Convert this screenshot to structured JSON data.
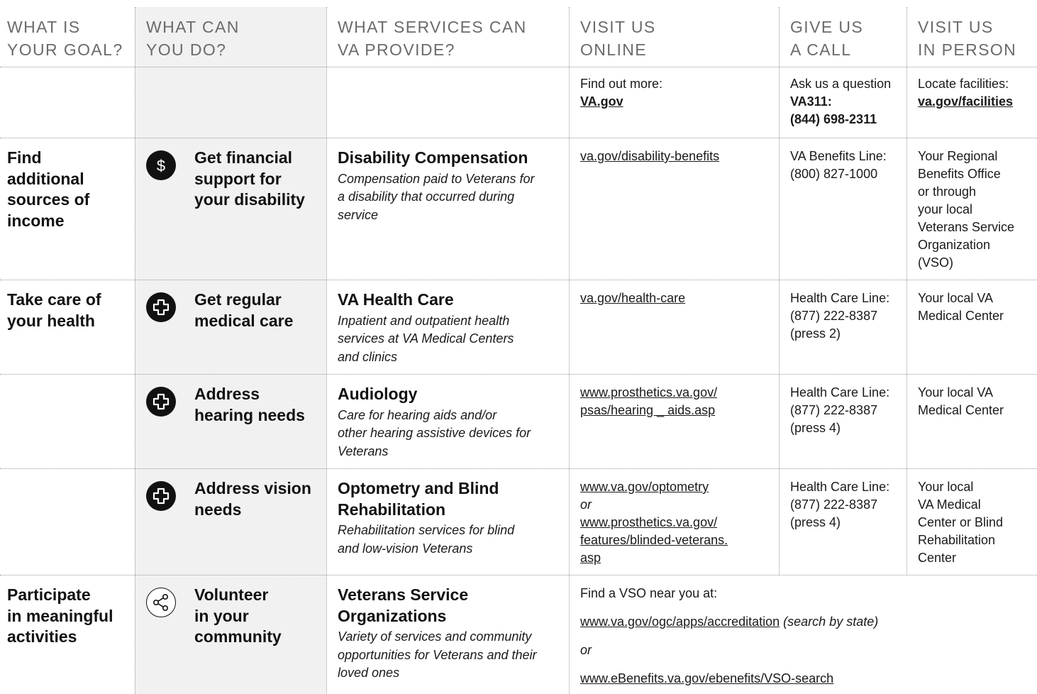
{
  "headers": {
    "goal": [
      "WHAT IS",
      "YOUR GOAL?"
    ],
    "do": [
      "WHAT CAN",
      "YOU DO?"
    ],
    "services": [
      "WHAT SERVICES CAN",
      "VA PROVIDE?"
    ],
    "online": [
      "VISIT US",
      "ONLINE"
    ],
    "call": [
      "GIVE US",
      "A CALL"
    ],
    "person": [
      "VISIT US",
      "IN PERSON"
    ]
  },
  "contact_row": {
    "online_label": "Find out more:",
    "online_link": "VA.gov",
    "call_label": "Ask us a question",
    "call_name": "VA311:",
    "call_number": "(844) 698-2311",
    "person_label": "Locate facilities:",
    "person_link": "va.gov/facilities"
  },
  "rows": [
    {
      "goal": [
        "Find",
        "additional",
        "sources of",
        "income"
      ],
      "icon": "dollar-icon",
      "action": [
        "Get financial",
        "support for",
        "your disability"
      ],
      "service_title": [
        "Disability Compensation"
      ],
      "service_desc": [
        "Compensation paid to Veterans for",
        "a disability that occurred during",
        "service"
      ],
      "online": [
        "va.gov/disability-benefits"
      ],
      "call": [
        "VA Benefits Line:",
        "(800) 827-1000"
      ],
      "person": [
        "Your Regional",
        "Benefits Office",
        "or through",
        "your local",
        "Veterans Service",
        "Organization",
        "(VSO)"
      ]
    },
    {
      "goal": [
        "Take care of",
        "your health"
      ],
      "icon": "medical-cross-icon",
      "action": [
        "Get regular",
        "medical care"
      ],
      "service_title": [
        "VA Health Care"
      ],
      "service_desc": [
        "Inpatient and outpatient health",
        "services at VA Medical Centers",
        "and clinics"
      ],
      "online": [
        "va.gov/health-care"
      ],
      "call": [
        "Health Care Line:",
        "(877) 222-8387",
        "(press 2)"
      ],
      "person": [
        "Your local VA",
        "Medical Center"
      ]
    },
    {
      "goal": [],
      "icon": "medical-cross-icon",
      "action": [
        "Address",
        "hearing needs"
      ],
      "service_title": [
        "Audiology"
      ],
      "service_desc": [
        "Care for hearing aids and/or",
        "other hearing assistive devices for",
        "Veterans"
      ],
      "online": [
        "www.prosthetics.va.gov/",
        "psas/hearing _ aids.asp"
      ],
      "call": [
        "Health Care Line:",
        "(877) 222-8387",
        "(press 4)"
      ],
      "person": [
        "Your local VA",
        "Medical Center"
      ]
    },
    {
      "goal": [],
      "icon": "medical-cross-icon",
      "action": [
        "Address vision",
        "needs"
      ],
      "service_title": [
        "Optometry and Blind",
        "Rehabilitation"
      ],
      "service_desc": [
        "Rehabilitation services for blind",
        "and low-vision Veterans"
      ],
      "online_link1": "www.va.gov/optometry",
      "online_or": "or",
      "online_link2": [
        "www.prosthetics.va.gov/",
        "features/blinded-veterans.",
        "asp"
      ],
      "call": [
        "Health Care Line:",
        "(877) 222-8387",
        "(press 4)"
      ],
      "person": [
        "Your local",
        "VA Medical",
        "Center or Blind",
        "Rehabilitation",
        "Center"
      ]
    },
    {
      "goal": [
        "Participate",
        "in meaningful",
        "activities"
      ],
      "icon": "share-icon",
      "action": [
        "Volunteer",
        "in your",
        "community"
      ],
      "service_title": [
        "Veterans Service",
        "Organizations"
      ],
      "service_desc": [
        "Variety of services and community",
        "opportunities for Veterans and their",
        "loved ones"
      ],
      "vso_intro": "Find a VSO near you at:",
      "vso_link1": "www.va.gov/ogc/apps/accreditation",
      "vso_note": " (search by state)",
      "vso_or": "or",
      "vso_link2": "www.eBenefits.va.gov/ebenefits/VSO-search"
    }
  ]
}
